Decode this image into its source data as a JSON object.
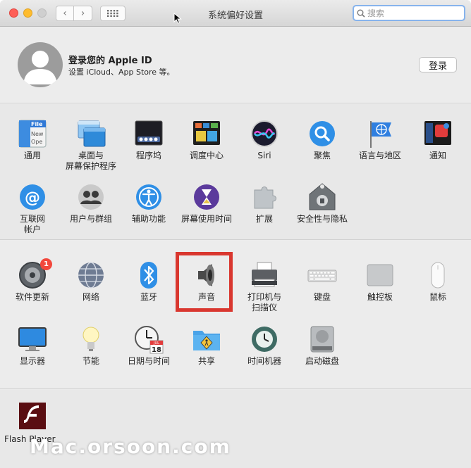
{
  "window": {
    "title": "系统偏好设置",
    "search_placeholder": "搜索"
  },
  "account": {
    "title": "登录您的 Apple ID",
    "subtitle": "设置 iCloud、App Store 等。",
    "login_label": "登录"
  },
  "row1": [
    {
      "label": "通用",
      "icon": "general-icon"
    },
    {
      "label": "桌面与\n屏幕保护程序",
      "icon": "desktop-screensaver-icon"
    },
    {
      "label": "程序坞",
      "icon": "dock-icon"
    },
    {
      "label": "调度中心",
      "icon": "mission-control-icon"
    },
    {
      "label": "Siri",
      "icon": "siri-icon"
    },
    {
      "label": "聚焦",
      "icon": "spotlight-icon"
    },
    {
      "label": "语言与地区",
      "icon": "language-region-icon"
    },
    {
      "label": "通知",
      "icon": "notifications-icon"
    }
  ],
  "row2": [
    {
      "label": "互联网\n帐户",
      "icon": "internet-accounts-icon"
    },
    {
      "label": "用户与群组",
      "icon": "users-groups-icon"
    },
    {
      "label": "辅助功能",
      "icon": "accessibility-icon"
    },
    {
      "label": "屏幕使用时间",
      "icon": "screen-time-icon"
    },
    {
      "label": "扩展",
      "icon": "extensions-icon"
    },
    {
      "label": "安全性与隐私",
      "icon": "security-privacy-icon"
    }
  ],
  "row3": [
    {
      "label": "软件更新",
      "icon": "software-update-icon",
      "badge": "1"
    },
    {
      "label": "网络",
      "icon": "network-icon"
    },
    {
      "label": "蓝牙",
      "icon": "bluetooth-icon"
    },
    {
      "label": "声音",
      "icon": "sound-icon"
    },
    {
      "label": "打印机与\n扫描仪",
      "icon": "printers-scanners-icon"
    },
    {
      "label": "键盘",
      "icon": "keyboard-icon"
    },
    {
      "label": "触控板",
      "icon": "trackpad-icon"
    },
    {
      "label": "鼠标",
      "icon": "mouse-icon"
    }
  ],
  "row4": [
    {
      "label": "显示器",
      "icon": "displays-icon"
    },
    {
      "label": "节能",
      "icon": "energy-saver-icon"
    },
    {
      "label": "日期与时间",
      "icon": "date-time-icon",
      "cal_month": "JUL",
      "cal_day": "18"
    },
    {
      "label": "共享",
      "icon": "sharing-icon"
    },
    {
      "label": "时间机器",
      "icon": "time-machine-icon"
    },
    {
      "label": "启动磁盘",
      "icon": "startup-disk-icon"
    }
  ],
  "other": [
    {
      "label": "Flash Player",
      "icon": "flash-player-icon"
    }
  ],
  "general_icon_text": "File\nNew\nOpe",
  "watermark": "Mac.orsoon.com",
  "colors": {
    "highlight": "#d9372f",
    "search_focus": "#86b3ec",
    "badge": "#f2473c"
  }
}
